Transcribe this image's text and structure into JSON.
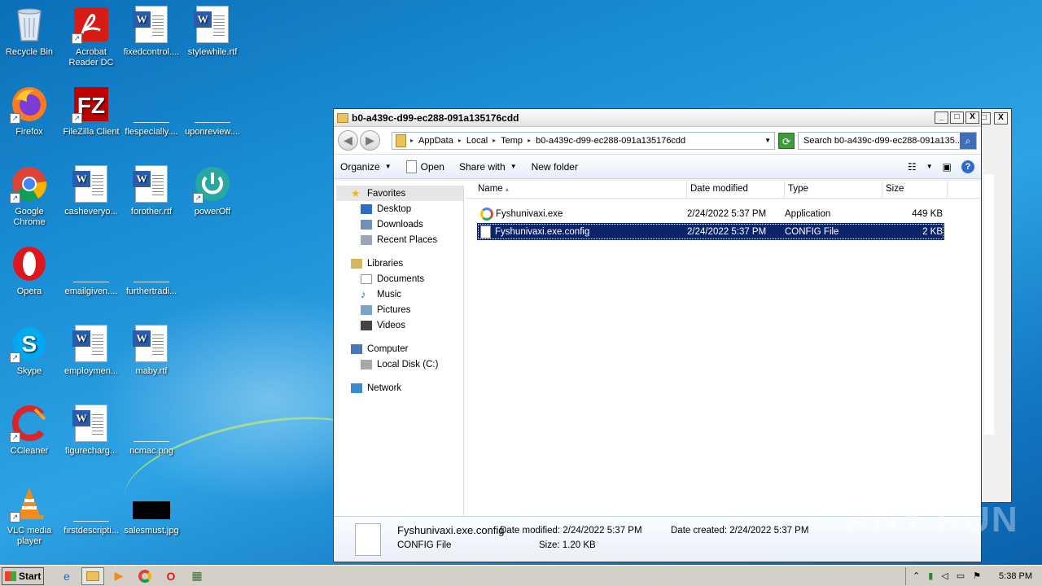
{
  "desktop": {
    "icons": [
      {
        "label": "Recycle Bin"
      },
      {
        "label": "Acrobat Reader DC"
      },
      {
        "label": "fixedcontrol...."
      },
      {
        "label": "stylewhile.rtf"
      },
      {
        "label": "Firefox"
      },
      {
        "label": "FileZilla Client"
      },
      {
        "label": "flespecially...."
      },
      {
        "label": "uponreview...."
      },
      {
        "label": "Google Chrome"
      },
      {
        "label": "casheveryo..."
      },
      {
        "label": "forother.rtf"
      },
      {
        "label": "powerOff"
      },
      {
        "label": "Opera"
      },
      {
        "label": "emailgiven...."
      },
      {
        "label": "furthertradi..."
      },
      {
        "label": "Skype"
      },
      {
        "label": "employmen..."
      },
      {
        "label": "maby.rtf"
      },
      {
        "label": "CCleaner"
      },
      {
        "label": "figurecharg..."
      },
      {
        "label": "ncmac.png"
      },
      {
        "label": "VLC media player"
      },
      {
        "label": "firstdescripti..."
      },
      {
        "label": "salesmust.jpg"
      }
    ]
  },
  "window": {
    "title": "b0-a439c-d99-ec288-091a135176cdd",
    "buttons": {
      "minimize": "_",
      "maximize": "□",
      "close": "X"
    },
    "nav": {
      "back": "◀",
      "forward": "▶"
    },
    "address": {
      "crumbs": [
        "AppData",
        "Local",
        "Temp",
        "b0-a439c-d99-ec288-091a135176cdd"
      ],
      "separator": "▸",
      "dropdown": "▼"
    },
    "search_placeholder": "Search b0-a439c-d99-ec288-091a135...",
    "toolbar": {
      "organize": "Organize",
      "open": "Open",
      "share_with": "Share with",
      "new_folder": "New folder",
      "help": "?"
    },
    "navpane": {
      "favorites": {
        "header": "Favorites",
        "items": [
          "Desktop",
          "Downloads",
          "Recent Places"
        ]
      },
      "libraries": {
        "header": "Libraries",
        "items": [
          "Documents",
          "Music",
          "Pictures",
          "Videos"
        ]
      },
      "computer": {
        "header": "Computer",
        "items": [
          "Local Disk (C:)"
        ]
      },
      "network": {
        "header": "Network"
      }
    },
    "columns": [
      "Name",
      "Date modified",
      "Type",
      "Size"
    ],
    "files": [
      {
        "name": "Fyshunivaxi.exe",
        "date": "2/24/2022 5:37 PM",
        "type": "Application",
        "size": "449 KB"
      },
      {
        "name": "Fyshunivaxi.exe.config",
        "date": "2/24/2022 5:37 PM",
        "type": "CONFIG File",
        "size": "2 KB"
      }
    ],
    "details": {
      "name": "Fyshunivaxi.exe.config",
      "type": "CONFIG File",
      "date_modified_label": "Date modified:",
      "date_modified": "2/24/2022 5:37 PM",
      "size_label": "Size:",
      "size": "1.20 KB",
      "date_created_label": "Date created:",
      "date_created": "2/24/2022 5:37 PM"
    }
  },
  "watermark": "ANY RUN",
  "taskbar": {
    "start": "Start",
    "clock": "5:38 PM"
  },
  "colors": {
    "selection": "#0a246a",
    "desktop": "#1b8fd6"
  }
}
